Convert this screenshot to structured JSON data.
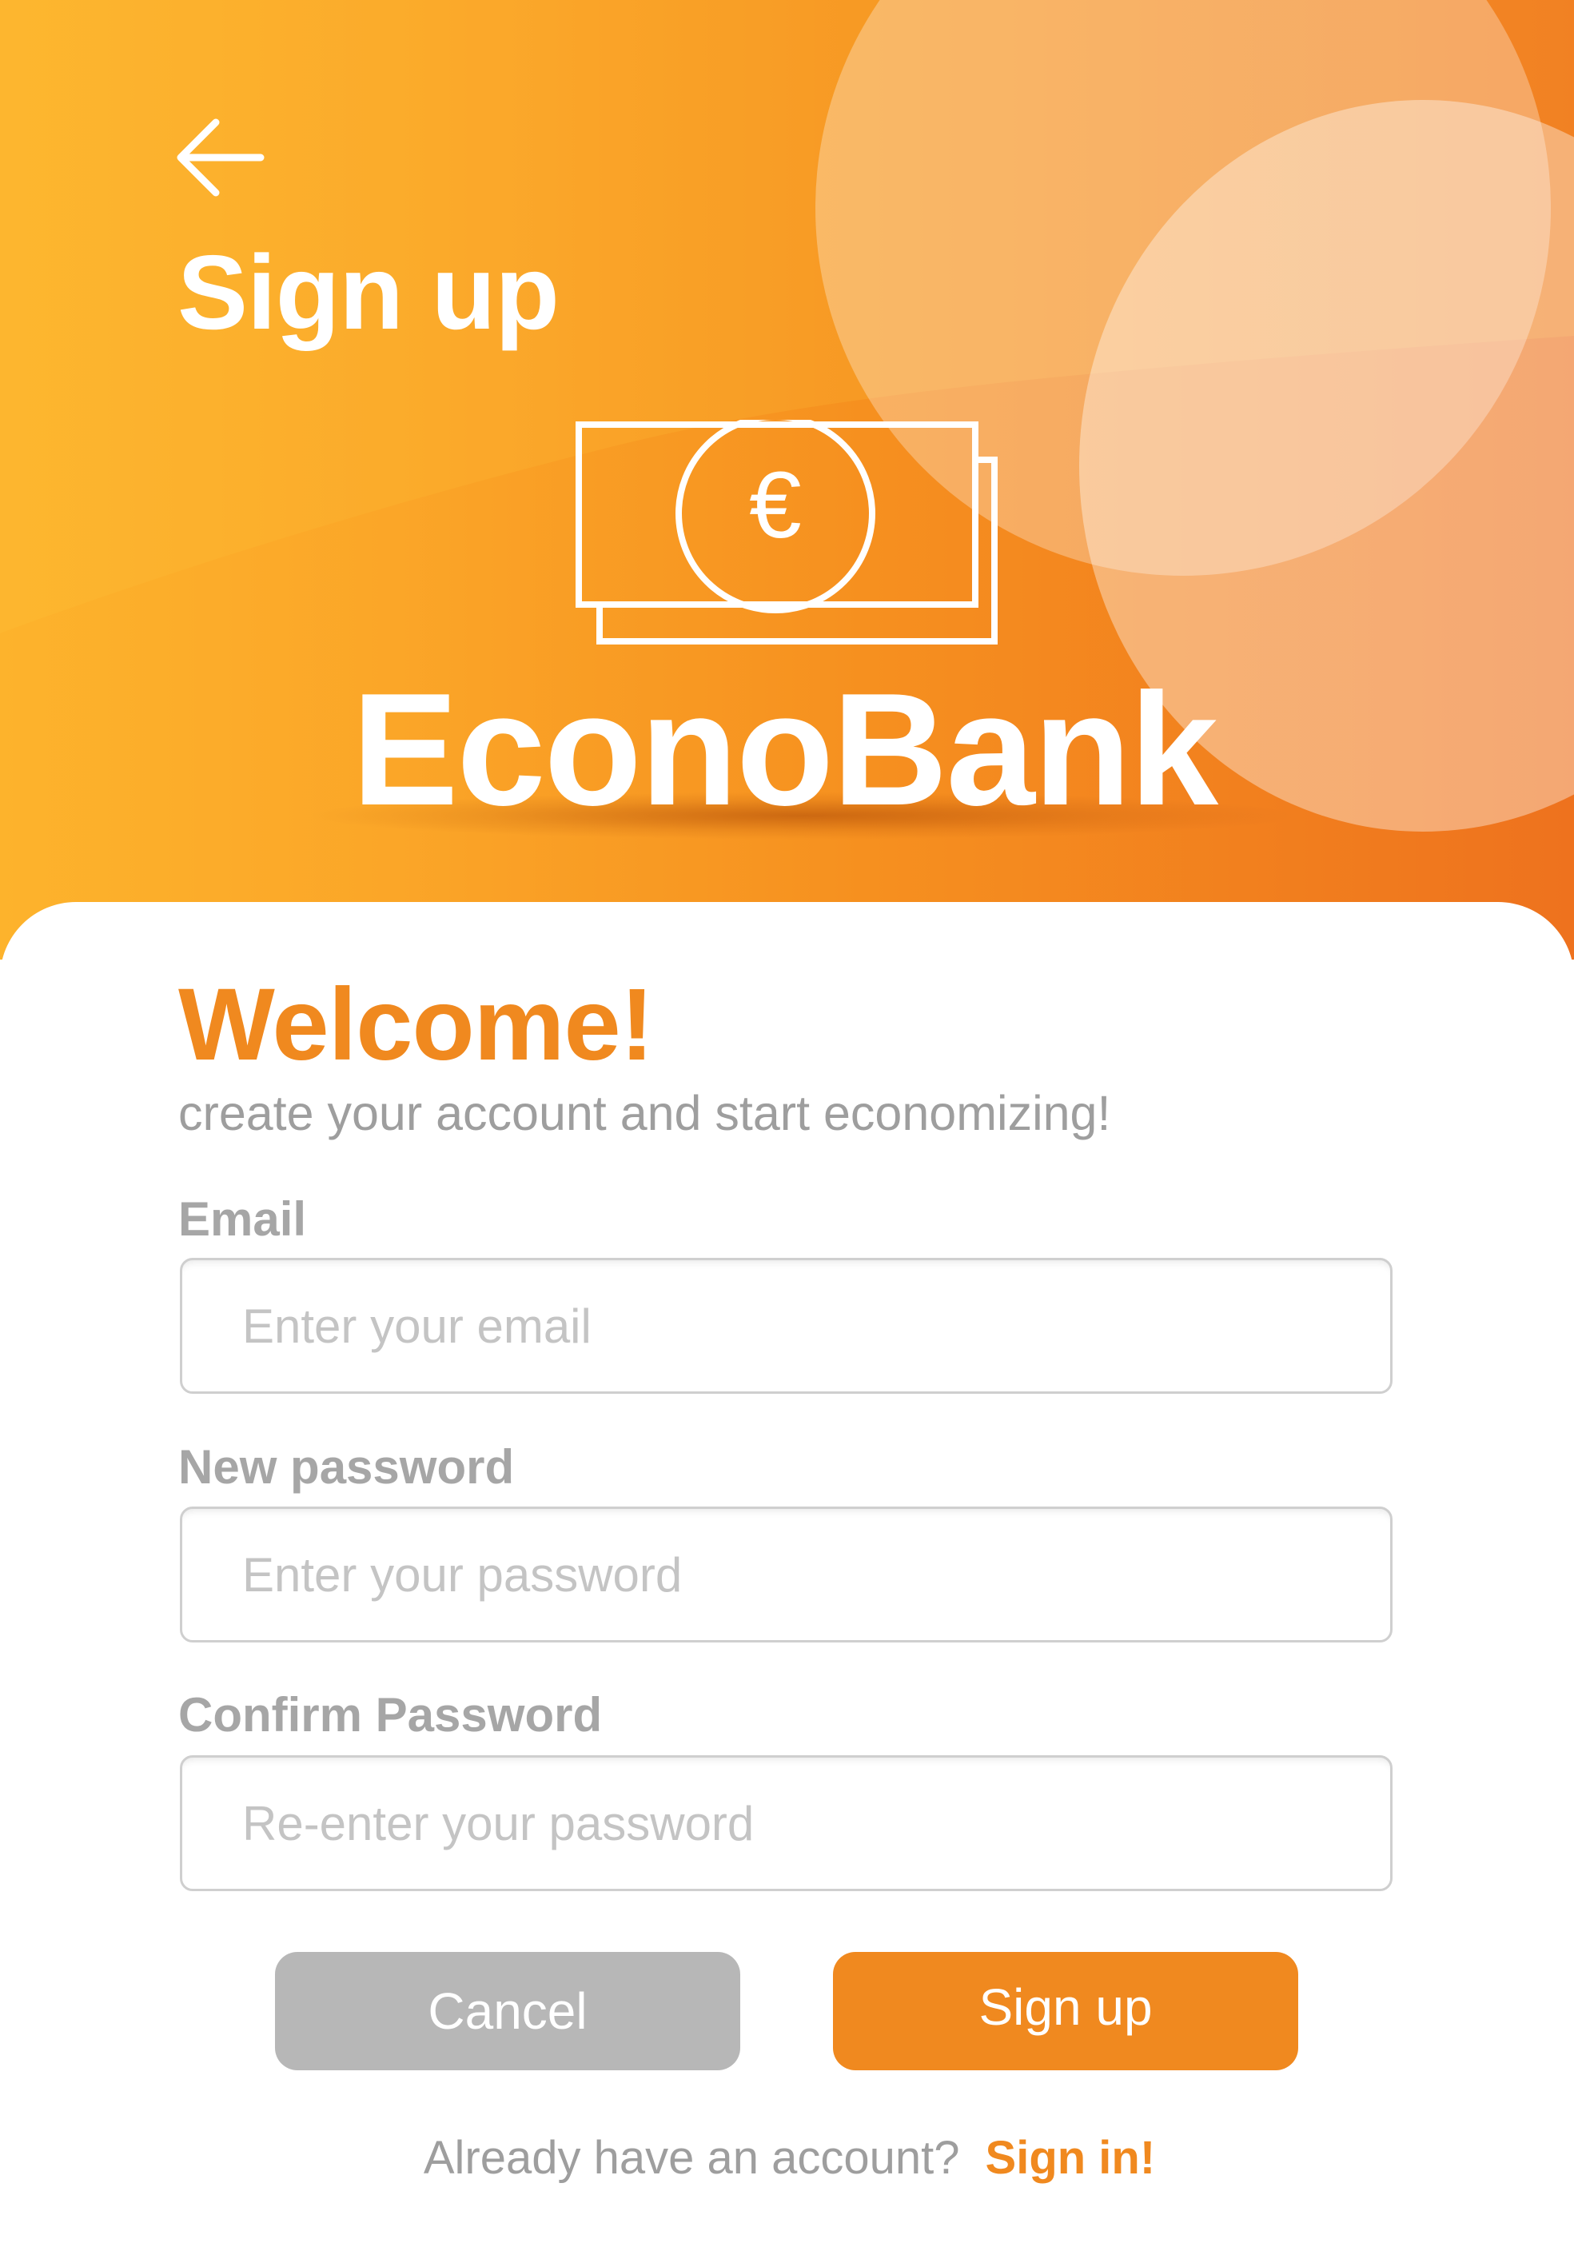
{
  "header": {
    "back_icon": "arrow-left-icon",
    "title": "Sign up",
    "logo_icon": "euro-banknote-icon",
    "logo_symbol": "€",
    "brand_name": "EconoBank"
  },
  "welcome": {
    "title": "Welcome!",
    "subtitle": "create your account and start economizing!"
  },
  "form": {
    "email": {
      "label": "Email",
      "value": "",
      "placeholder": "Enter your email"
    },
    "new_password": {
      "label": "New password",
      "value": "",
      "placeholder": "Enter your password"
    },
    "confirm_password": {
      "label": "Confirm Password",
      "value": "",
      "placeholder": "Re-enter your password"
    }
  },
  "actions": {
    "cancel_label": "Cancel",
    "signup_label": "Sign up"
  },
  "footer": {
    "prompt": "Already have an account?",
    "link_label": "Sign in!"
  },
  "colors": {
    "accent": "#f0891f",
    "header_gradient_start": "#fdb32c",
    "header_gradient_end": "#ee721e",
    "muted_text": "#9e9e9e",
    "cancel_button": "#b7b7b7"
  }
}
